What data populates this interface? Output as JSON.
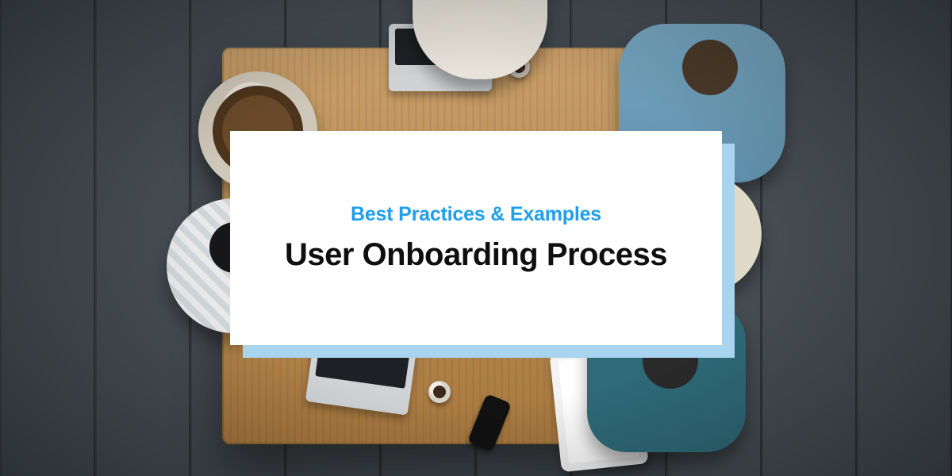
{
  "card": {
    "eyebrow": "Best Practices & Examples",
    "headline": "User Onboarding Process"
  },
  "colors": {
    "accent": "#1f9eea",
    "card_shadow": "#a9d4ef",
    "card_bg": "#ffffff",
    "headline": "#0f0f0f"
  },
  "scene": {
    "description": "Overhead photo of six colleagues seated around a wooden meeting table on a dark plank floor, with laptops, a tablet, a phone, and coffee mugs."
  }
}
